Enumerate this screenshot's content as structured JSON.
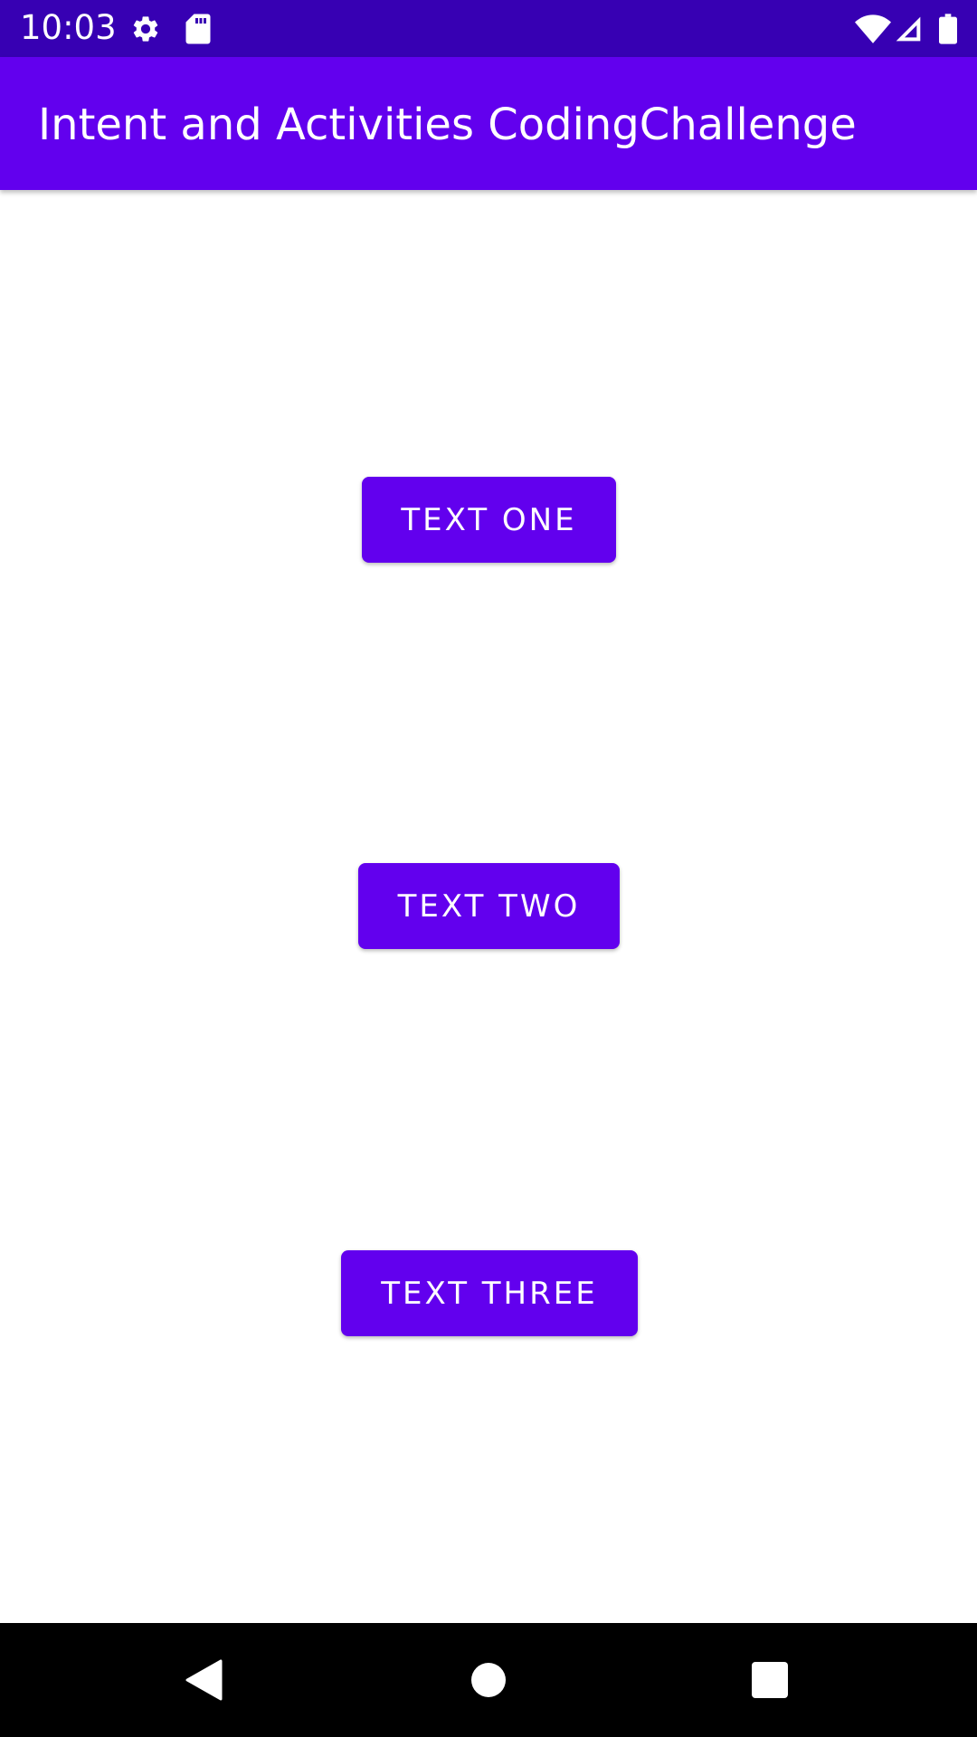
{
  "status_bar": {
    "time": "10:03",
    "icons": [
      "settings-icon",
      "sd-card-icon",
      "wifi-icon",
      "signal-icon",
      "battery-icon"
    ],
    "background": "#3700B3"
  },
  "app_bar": {
    "title": "Intent and Activities CodingChallenge",
    "background": "#6200EE"
  },
  "main": {
    "buttons": [
      {
        "label": "TEXT ONE"
      },
      {
        "label": "TEXT TWO"
      },
      {
        "label": "TEXT THREE"
      }
    ],
    "button_color": "#6200EE"
  },
  "nav_bar": {
    "icons": [
      "back-icon",
      "home-icon",
      "recents-icon"
    ],
    "background": "#000000"
  }
}
